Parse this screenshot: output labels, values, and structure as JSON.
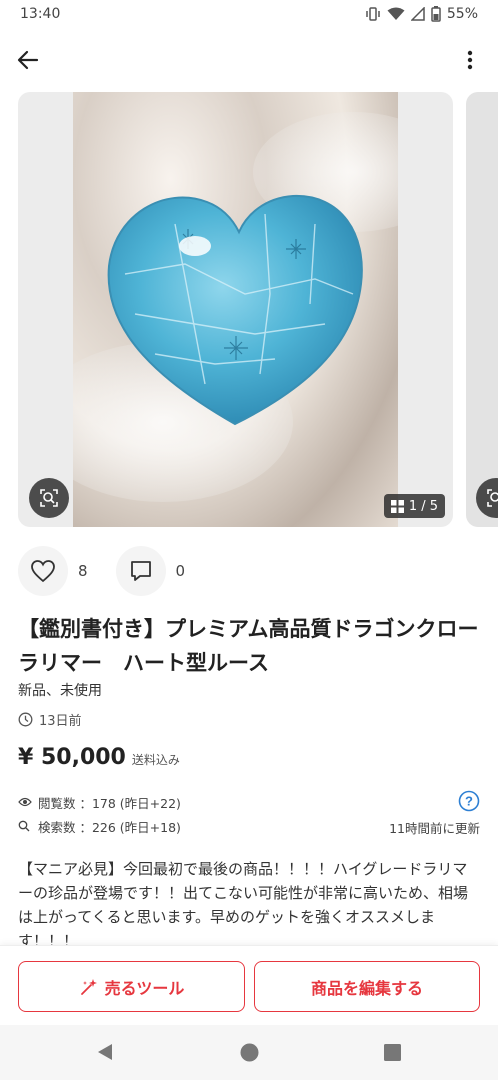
{
  "status_bar": {
    "time": "13:40",
    "battery": "55%"
  },
  "carousel": {
    "page_indicator": "1 / 5"
  },
  "actions": {
    "likes": "8",
    "comments": "0"
  },
  "item": {
    "title": "【鑑別書付き】プレミアム高品質ドラゴンクローラリマー　ハート型ルース",
    "condition": "新品、未使用",
    "posted": "13日前",
    "price": "¥ 50,000",
    "shipping": "送料込み"
  },
  "stats": {
    "views": "閲覧数 ：178 (昨日+22)",
    "searches": "検索数 ：226 (昨日+18)",
    "updated": "11時間前に更新"
  },
  "description": "【マニア必見】今回最初で最後の商品！！！！ハイグレードラリマーの珍品が登場です！！出てこない可能性が非常に高いため、相場は上がってくると思います。早めのゲットを強くオススメします！！！",
  "buttons": {
    "sell_tool": "売るツール",
    "edit_item": "商品を編集する"
  },
  "colors": {
    "accent": "#e6373f",
    "heart_stone": "#4fb4d6"
  }
}
